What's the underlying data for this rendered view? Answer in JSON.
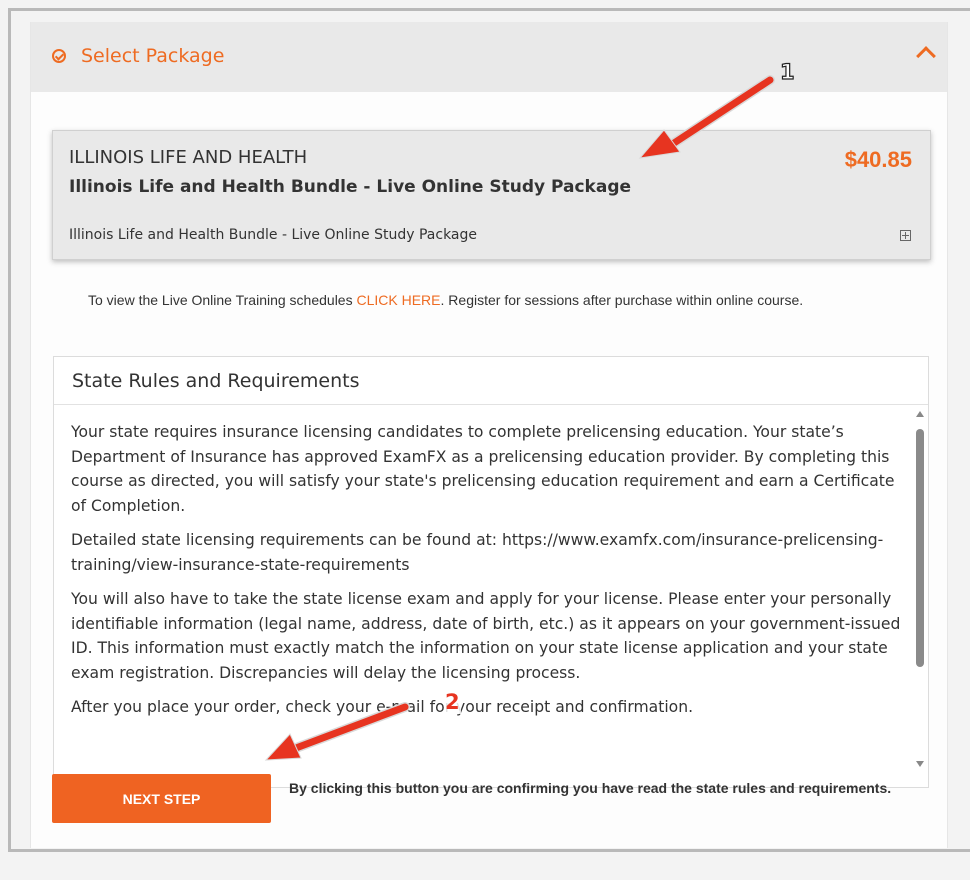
{
  "header": {
    "title": "Select Package",
    "icons": {
      "left": "check-circle-icon",
      "right": "chevron-up-icon"
    }
  },
  "package": {
    "category": "ILLINOIS LIFE AND HEALTH",
    "name": "Illinois Life and Health Bundle - Live Online Study Package",
    "price": "$40.85",
    "description": "Illinois Life and Health Bundle - Live Online Study Package",
    "expand_icon": "plus-square-icon"
  },
  "schedule_note": {
    "before": "To view the Live Online Training schedules ",
    "link": "CLICK HERE",
    "after": ". Register for sessions after purchase within online course."
  },
  "rules": {
    "title": "State Rules and Requirements",
    "paragraphs": [
      "Your state requires insurance licensing candidates to complete prelicensing education. Your state’s Department of Insurance has approved ExamFX as a prelicensing education provider. By completing this course as directed, you will satisfy your state's prelicensing education requirement and earn a Certificate of Completion.",
      "Detailed state licensing requirements can be found at: https://www.examfx.com/insurance-prelicensing-training/view-insurance-state-requirements",
      "You will also have to take the state license exam and apply for your license. Please enter your personally identifiable information (legal name, address, date of birth, etc.) as it appears on your government-issued ID. This information must exactly match the information on your state license application and your state exam registration. Discrepancies will delay the licensing process.",
      "After you place your order, check your e-mail for your receipt and confirmation."
    ]
  },
  "next_step": {
    "label": "NEXT STEP",
    "note": "By clicking this button you are confirming you have read the state rules and requirements."
  },
  "annotations": {
    "marker_1": "1",
    "marker_2": "2",
    "arrow_color": "#e73420"
  },
  "colors": {
    "accent": "#ee6b22",
    "button": "#ef6322"
  }
}
